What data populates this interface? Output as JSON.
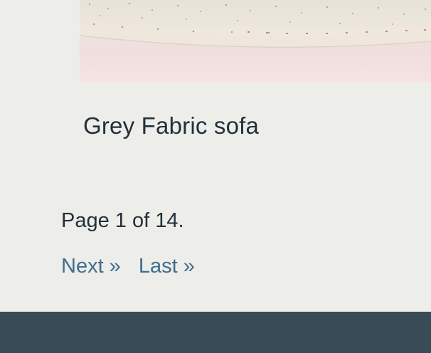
{
  "product": {
    "title": "Grey Fabric sofa",
    "image_icon": "product-photo"
  },
  "pagination": {
    "info": "Page 1 of 14.",
    "next_label": "Next »",
    "last_label": "Last »"
  },
  "colors": {
    "background": "#edede9",
    "text": "#22303a",
    "link": "#3f6d8f",
    "footer": "#394b57"
  }
}
